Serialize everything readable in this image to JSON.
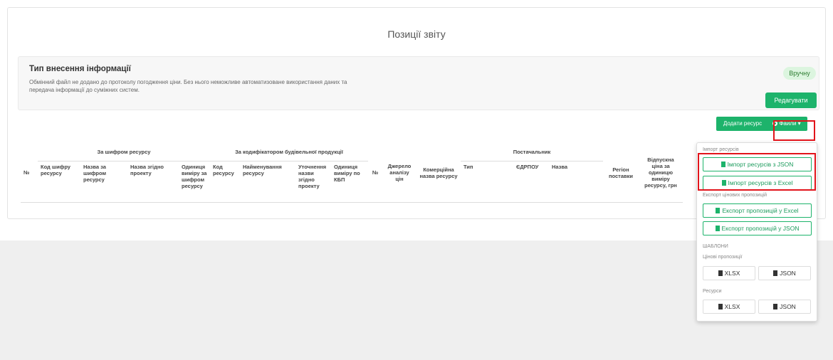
{
  "page": {
    "title": "Позиції звіту"
  },
  "info_panel": {
    "title": "Тип внесення інформації",
    "description": "Обмінний файл не додано до протоколу погодження ціни. Без нього неможливе автоматизоване використання даних та передача інформації до суміжних систем.",
    "mode_badge": "Вручну",
    "edit_button": "Редагувати"
  },
  "toolbar": {
    "add_resource_button": "Додати ресурс",
    "files_button": "Файли ▾",
    "files_icon": "gear-icon"
  },
  "table": {
    "groups": {
      "num": "№",
      "by_resource_code": "За шифром ресурсу",
      "by_classifier": "За кодифікатором будівельної продукції",
      "num2": "№",
      "source": "Джерело аналізу цін",
      "commercial_name": "Комерційна назва ресурсу",
      "supplier": "Постачальник",
      "region": "Регіон поставки",
      "price": "Відпускна ціна за одиницю виміру ресурсу, грн"
    },
    "sub": {
      "code": "Код шифру ресурсу",
      "name_by_code": "Назва за шифром ресурсу",
      "name_by_project": "Назва згідно проекту",
      "unit_by_code": "Одиниця виміру за шифром ресурсу",
      "resource_code": "Код ресурсу",
      "resource_name": "Найменування ресурсу",
      "name_refinement": "Уточнення назви згідно проекту",
      "unit_kbp": "Одиниця виміру по КБП",
      "supplier_type": "Тип",
      "edrpou": "ЄДРПОУ",
      "supplier_name": "Назва"
    }
  },
  "files_menu": {
    "import_section": "Імпорт ресурсів",
    "import_json": "Імпорт ресурсів з JSON",
    "import_excel": "Імпорт ресурсів з Excel",
    "export_section": "Експорт цінових пропозицій",
    "export_excel": "Експорт пропозицій у Excel",
    "export_json": "Експорт пропозицій у JSON",
    "templates_section": "ШАБЛОНИ",
    "price_offers_label": "Цінові пропозиції",
    "resources_label": "Ресурси",
    "xlsx": "XLSX",
    "json": "JSON"
  },
  "colors": {
    "accent": "#1db36b",
    "badge_bg": "#dcf5df",
    "annotation": "#e2141b"
  }
}
